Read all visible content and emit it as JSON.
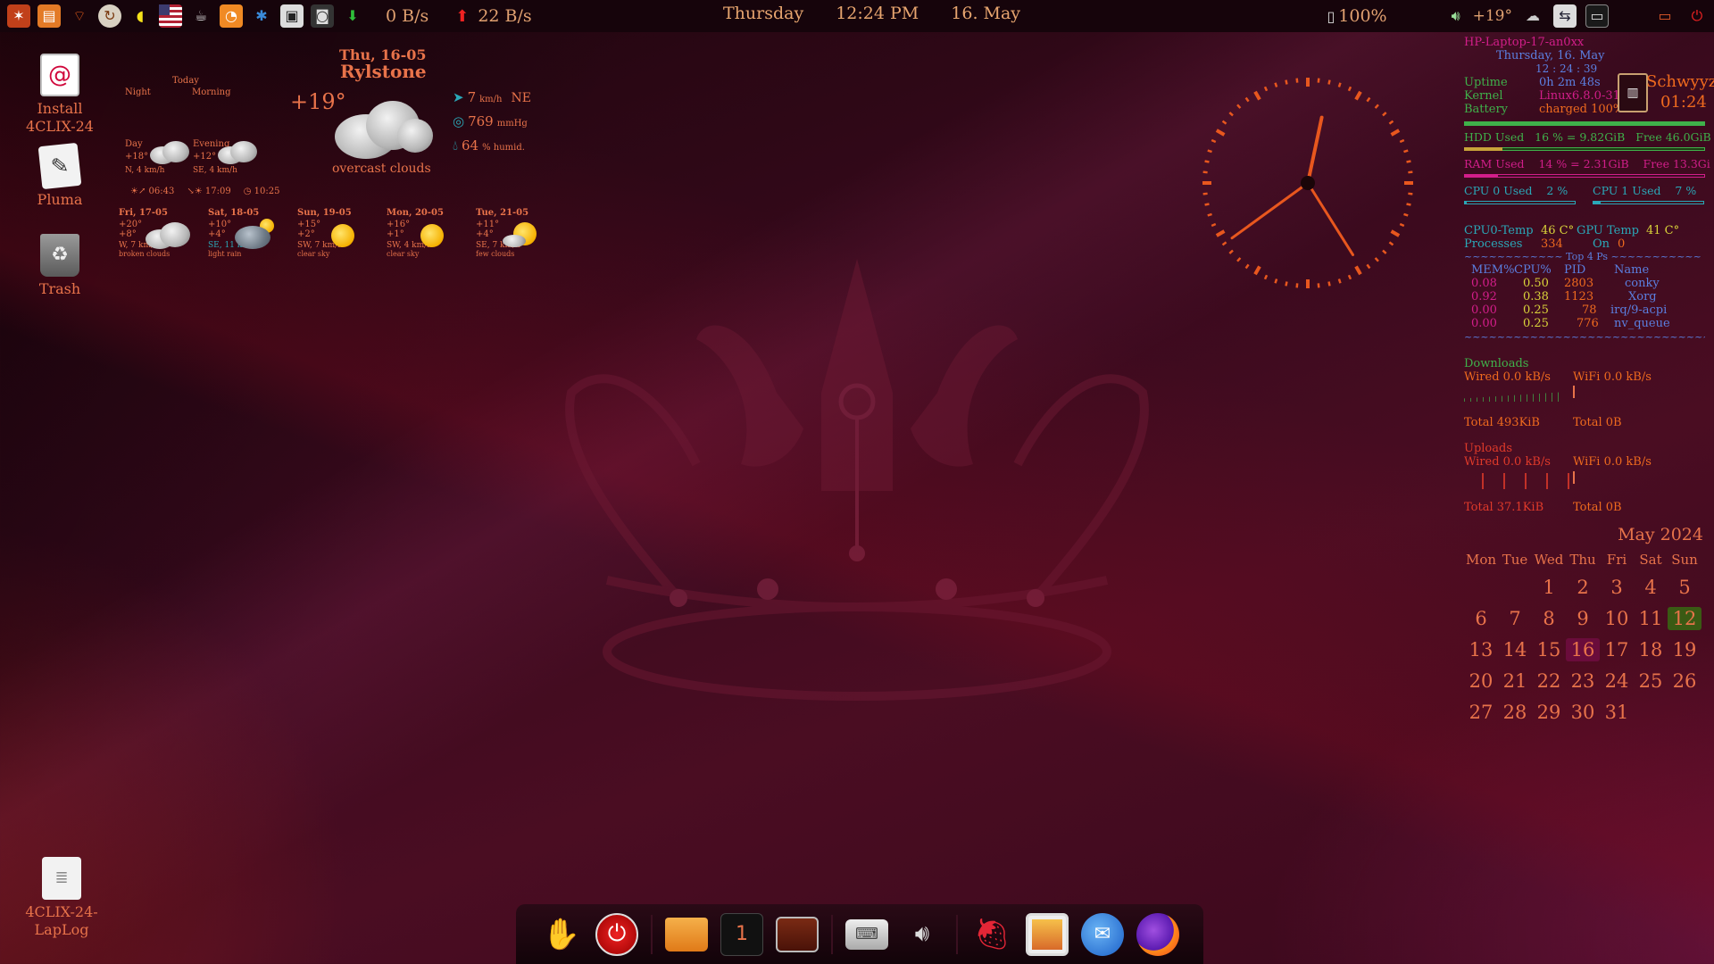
{
  "topbar": {
    "net_down": "0 B/s",
    "net_up": "22 B/s",
    "day": "Thursday",
    "time": "12:24 PM",
    "date": "16. May",
    "battery": "100%",
    "tray_temp": "+19°",
    "icons": [
      "menu-icon",
      "files-icon",
      "network-tower-icon",
      "sync-icon",
      "note-icon",
      "us-flag-icon",
      "cup-icon",
      "feed-icon",
      "bluetooth-icon",
      "screen-icon",
      "camera-icon",
      "download-icon"
    ],
    "tray_icons": [
      "battery-icon",
      "volume-icon",
      "weather-cloud-icon",
      "remote-icon",
      "monitor-icon",
      "display-icon",
      "power-icon"
    ]
  },
  "desktop": {
    "icons": [
      {
        "name": "debian-install-icon",
        "label": "Install 4CLIX-24"
      },
      {
        "name": "pluma-icon",
        "label": "Pluma"
      },
      {
        "name": "trash-icon",
        "label": "Trash"
      },
      {
        "name": "laplog-icon",
        "label": "4CLIX-24-LapLog"
      }
    ]
  },
  "weather": {
    "date": "Thu, 16-05",
    "location": "Rylstone",
    "temp": "+19°",
    "condition": "overcast clouds",
    "wind": "7",
    "wind_unit": "km/h",
    "wind_dir": "NE",
    "pressure": "769",
    "pressure_unit": "mmHg",
    "humidity": "64",
    "humidity_unit": "% humid.",
    "today_label": "Today",
    "night_label": "Night",
    "morning_label": "Morning",
    "day_label": "Day",
    "day_temp": "+18°",
    "day_wind": "N, 4 km/h",
    "evening_label": "Evening",
    "evening_temp": "+12°",
    "evening_wind": "SE, 4 km/h",
    "sunrise": "06:43",
    "sunset": "17:09",
    "daylength": "10:25",
    "forecast": [
      {
        "day": "Fri, 17-05",
        "hi": "+20°",
        "lo": "+8°",
        "wind": "W, 7 km/h",
        "desc": "broken clouds",
        "icon": "cloud"
      },
      {
        "day": "Sat, 18-05",
        "hi": "+10°",
        "lo": "+4°",
        "wind": "SE, 11 km/h",
        "desc": "light rain",
        "icon": "rain"
      },
      {
        "day": "Sun, 19-05",
        "hi": "+15°",
        "lo": "+2°",
        "wind": "SW, 7 km/h",
        "desc": "clear sky",
        "icon": "sun"
      },
      {
        "day": "Mon, 20-05",
        "hi": "+16°",
        "lo": "+1°",
        "wind": "SW, 4 km/h",
        "desc": "clear sky",
        "icon": "sun"
      },
      {
        "day": "Tue, 21-05",
        "hi": "+11°",
        "lo": "+4°",
        "wind": "SE, 7 km/h",
        "desc": "few clouds",
        "icon": "sun-cloud"
      }
    ]
  },
  "clock": {
    "hour": 12,
    "minute": 24,
    "second": 39
  },
  "conky": {
    "host": "HP-Laptop-17-an0xx",
    "date": "Thursday,  16. May",
    "time": "12 : 24 : 39",
    "uptime_label": "Uptime",
    "uptime": "0h 2m 48s",
    "kernel_label": "Kernel",
    "kernel": "Linux6.8.0-31",
    "battery_label": "Battery",
    "battery": "charged 100%",
    "tz_city": "Schwyyz",
    "tz_time": "01:24",
    "hdd": "HDD Used   16 % = 9.82GiB   Free 46.0GiB",
    "hdd_pct": 16,
    "ram": "RAM Used    14 % = 2.31GiB    Free 13.3Gi",
    "ram_pct": 14,
    "cpu0": "CPU 0 Used    2 %",
    "cpu0_pct": 2,
    "cpu1": "CPU 1 Used    7 %",
    "cpu1_pct": 7,
    "cpu0_temp_label": "CPU0-Temp",
    "cpu0_temp": "46 C°",
    "gpu_temp_label": "GPU Temp",
    "gpu_temp": "41 C°",
    "processes_label": "Processes",
    "processes": "334",
    "on_label": "On",
    "on": "0",
    "top_title": "~~~~~~~~~~~~ Top 4 Ps ~~~~~~~~~~~",
    "top_headers": [
      "MEM%",
      "CPU%",
      "PID",
      "Name"
    ],
    "top": [
      [
        "0.08",
        "0.50",
        "2803",
        "conky"
      ],
      [
        "0.92",
        "0.38",
        "1123",
        "Xorg"
      ],
      [
        "0.00",
        "0.25",
        "78",
        "irq/9-acpi"
      ],
      [
        "0.00",
        "0.25",
        "776",
        "nv_queue"
      ]
    ],
    "rule": "~~~~~~~~~~~~~~~~~~~~~~~~~~~~~~~~~~~~~~~",
    "downloads_label": "Downloads",
    "wired_down": "Wired 0.0 kB/s",
    "wifi_down": "WiFi 0.0 kB/s",
    "total_down_wired": "Total 493KiB",
    "total_down_wifi": "Total 0B",
    "uploads_label": "Uploads",
    "wired_up": "Wired 0.0 kB/s",
    "wifi_up": "WiFi 0.0 kB/s",
    "total_up_wired": "Total 37.1KiB",
    "total_up_wifi": "Total 0B"
  },
  "calendar": {
    "title": "May 2024",
    "headers": [
      "Mon",
      "Tue",
      "Wed",
      "Thu",
      "Fri",
      "Sat",
      "Sun"
    ],
    "offset": 2,
    "days": 31,
    "today": 16,
    "marked": 12
  },
  "dock": {
    "items": [
      "gnome-foot-icon",
      "power-icon",
      "folder-icon",
      "workspace-icon",
      "terminal-icon",
      "keyboard-icon",
      "volume-icon",
      "strawberry-icon",
      "image-viewer-icon",
      "thunderbird-icon",
      "firefox-icon"
    ],
    "workspace_number": "1"
  },
  "colors": {
    "accent": "#e8734a",
    "green": "#3fb14a",
    "magenta": "#d21e8a",
    "cyan": "#2aa8b8"
  }
}
